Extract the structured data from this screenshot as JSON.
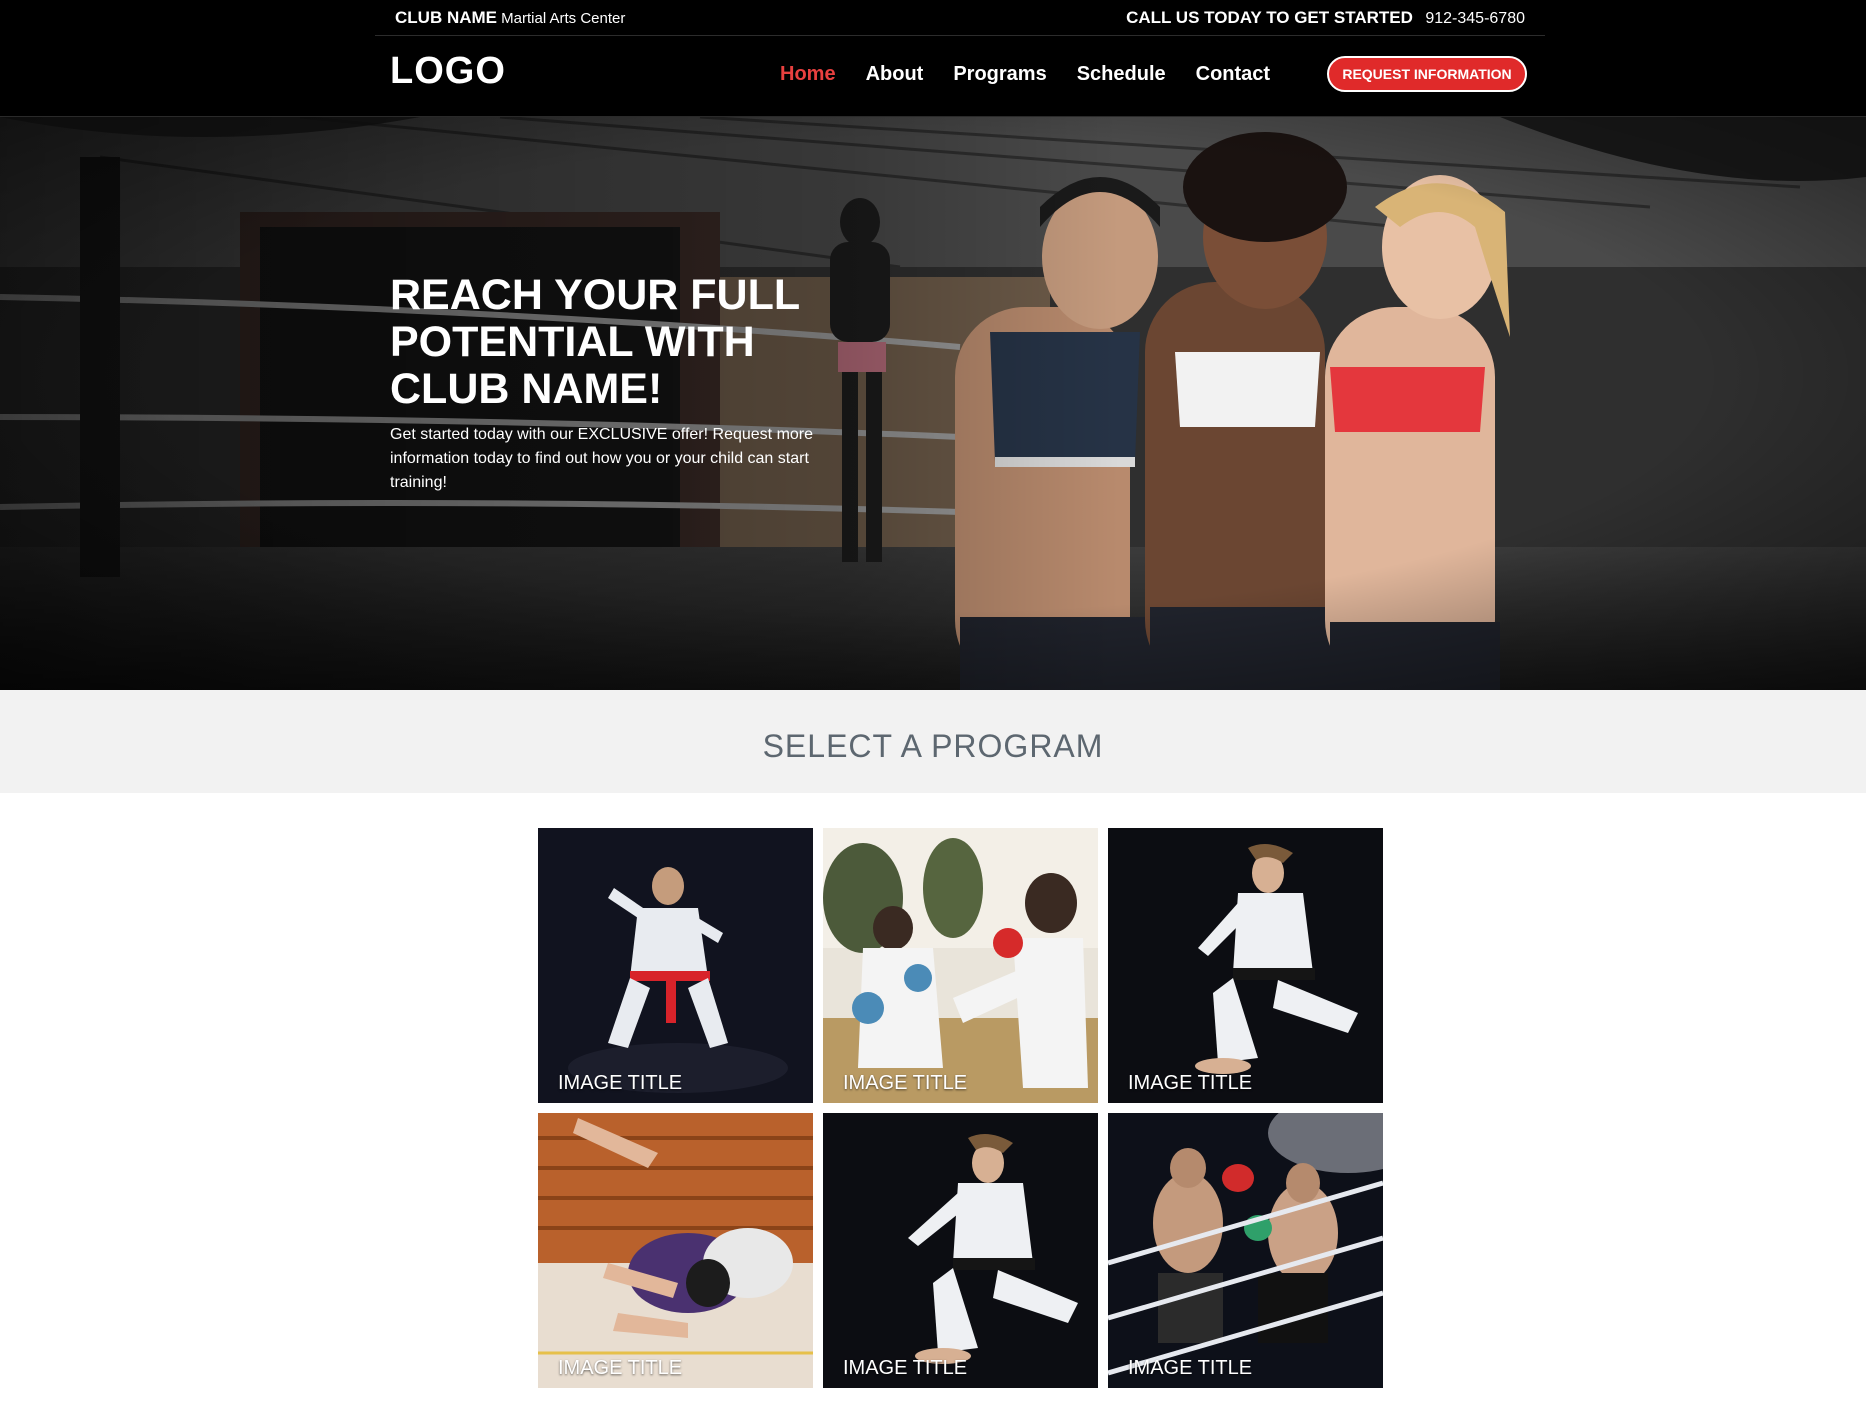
{
  "topbar": {
    "club_name": "CLUB NAME",
    "club_subtitle": "Martial Arts Center",
    "call_text": "CALL US TODAY TO GET STARTED",
    "phone": "912-345-6780"
  },
  "header": {
    "logo": "LOGO",
    "nav": [
      {
        "label": "Home",
        "active": true
      },
      {
        "label": "About",
        "active": false
      },
      {
        "label": "Programs",
        "active": false
      },
      {
        "label": "Schedule",
        "active": false
      },
      {
        "label": "Contact",
        "active": false
      }
    ],
    "cta_label": "REQUEST INFORMATION"
  },
  "hero": {
    "title": "REACH YOUR FULL POTENTIAL WITH CLUB NAME!",
    "text": "Get started today with our EXCLUSIVE offer! Request more information today to find out how you or your child can start training!"
  },
  "programs": {
    "heading": "SELECT A PROGRAM",
    "tiles": [
      {
        "title": "IMAGE TITLE"
      },
      {
        "title": "IMAGE TITLE"
      },
      {
        "title": "IMAGE TITLE"
      },
      {
        "title": "IMAGE TITLE"
      },
      {
        "title": "IMAGE TITLE"
      },
      {
        "title": "IMAGE TITLE"
      }
    ]
  },
  "colors": {
    "accent": "#e02a2a",
    "nav_active": "#e8403f",
    "header_bg": "#000000",
    "band_bg": "#f2f2f2",
    "heading_text": "#5d6770"
  }
}
